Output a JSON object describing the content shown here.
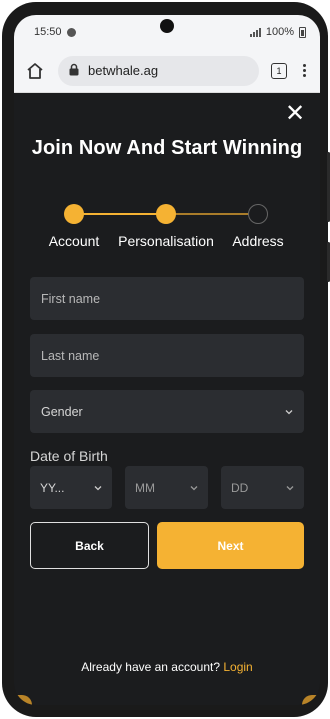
{
  "status": {
    "time": "15:50",
    "battery": "100%"
  },
  "browser": {
    "url": "betwhale.ag",
    "tab_count": "1"
  },
  "modal": {
    "title": "Join Now And Start Winning",
    "steps": [
      {
        "label": "Account",
        "state": "done"
      },
      {
        "label": "Personalisation",
        "state": "done"
      },
      {
        "label": "Address",
        "state": "todo"
      }
    ],
    "fields": {
      "first_name": "First name",
      "last_name": "Last name",
      "gender": "Gender"
    },
    "dob": {
      "label": "Date of Birth",
      "year": "YY...",
      "month": "MM",
      "day": "DD"
    },
    "buttons": {
      "back": "Back",
      "next": "Next"
    },
    "login": {
      "prompt": "Already have an account?",
      "link": "Login"
    }
  },
  "colors": {
    "accent": "#f5b233",
    "background": "#1b1c1e",
    "field": "#2b2d31"
  }
}
